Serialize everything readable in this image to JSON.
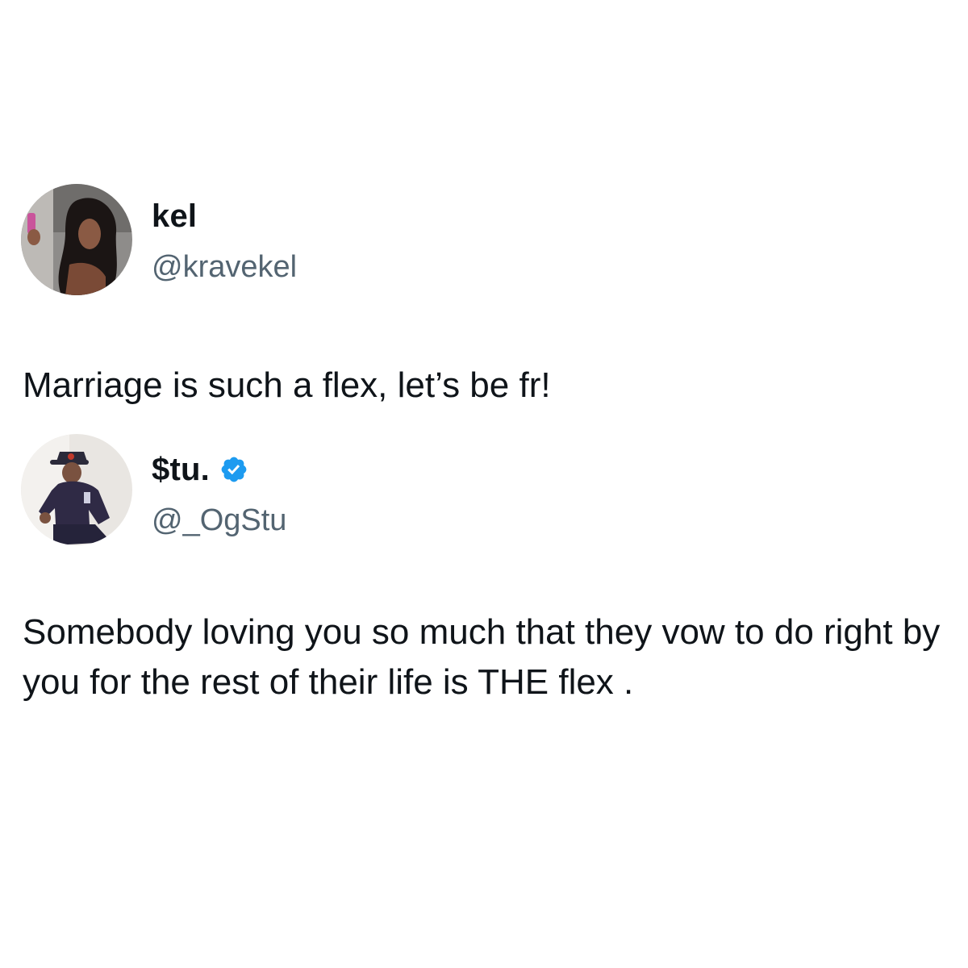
{
  "tweets": [
    {
      "display_name": "kel",
      "handle": "@kravekel",
      "verified": false,
      "avatar_icon": "user-photo-avatar",
      "text": "Marriage is such a flex, let’s be fr!"
    },
    {
      "display_name": "$tu.",
      "handle": "@_OgStu",
      "verified": true,
      "verified_color": "#1d9bf0",
      "avatar_icon": "user-photo-avatar",
      "text": "Somebody loving you so much that they vow to do right by you for the rest of their life is THE flex ."
    }
  ],
  "colors": {
    "text_primary": "#0f1419",
    "text_secondary": "#536471",
    "verified": "#1d9bf0",
    "background": "#ffffff"
  }
}
